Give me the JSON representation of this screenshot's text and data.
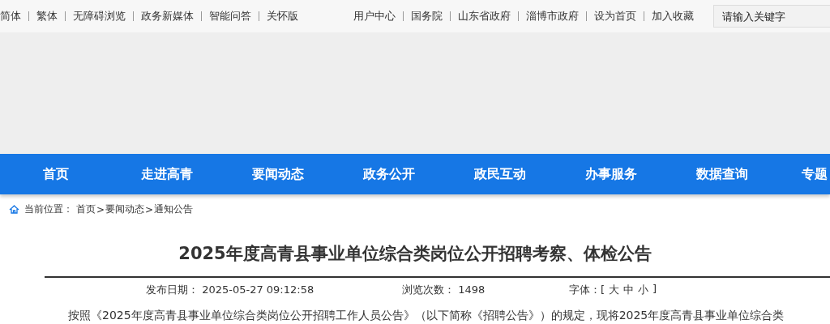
{
  "top_links_left": [
    "简体",
    "繁体",
    "无障碍浏览",
    "政务新媒体",
    "智能问答",
    "关怀版"
  ],
  "top_links_right": [
    "用户中心",
    "国务院",
    "山东省政府",
    "淄博市政府",
    "设为首页",
    "加入收藏"
  ],
  "search": {
    "placeholder": "请输入关键字"
  },
  "nav": [
    {
      "label": "首页"
    },
    {
      "label": "走进高青"
    },
    {
      "label": "要闻动态"
    },
    {
      "label": "政务公开"
    },
    {
      "label": "政民互动"
    },
    {
      "label": "办事服务"
    },
    {
      "label": "数据查询"
    },
    {
      "label": "专题"
    }
  ],
  "breadcrumb": {
    "label": "当前位置：",
    "items": [
      "首页",
      "要闻动态",
      "通知公告"
    ],
    "separator": ">"
  },
  "article": {
    "title": "2025年度高青县事业单位综合类岗位公开招聘考察、体检公告",
    "meta": [
      {
        "label": "发布日期：",
        "value": "2025-05-27 09:12:58"
      },
      {
        "label": "浏览次数：",
        "value": "1498"
      }
    ],
    "font_size": {
      "label": "字体：",
      "open": "[",
      "options": [
        "大",
        "中",
        "小"
      ],
      "close": "]"
    },
    "paragraph": "按照《2025年度高青县事业单位综合类岗位公开招聘工作人员公告》（以下简称《招聘公告》）的规定，现将2025年度高青县事业单位综合类"
  }
}
